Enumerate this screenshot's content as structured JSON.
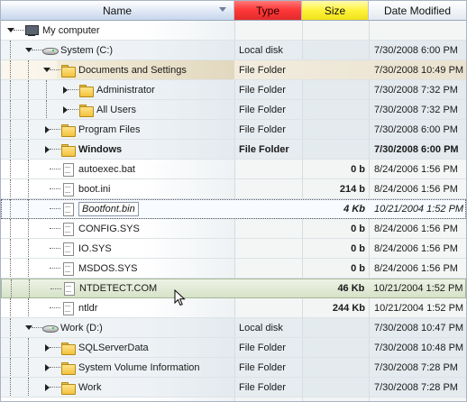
{
  "columns": {
    "name": "Name",
    "type": "Type",
    "size": "Size",
    "date": "Date Modified"
  },
  "colors": {
    "type_header": "#ff3a3a",
    "size_header": "#fff23a",
    "name_header": "#c6d6ec"
  },
  "rows": [
    {
      "name": "My computer",
      "type": "",
      "size": "",
      "date": "",
      "icon": "computer-icon",
      "level": 0,
      "expander": "open"
    },
    {
      "name": "System (C:)",
      "type": "Local disk",
      "size": "",
      "date": "7/30/2008 6:00 PM",
      "icon": "drive-icon",
      "level": 1,
      "expander": "open"
    },
    {
      "name": "Documents and Settings",
      "type": "File Folder",
      "size": "",
      "date": "7/30/2008 10:49 PM",
      "icon": "folder-icon",
      "level": 2,
      "expander": "open"
    },
    {
      "name": "Administrator",
      "type": "File Folder",
      "size": "",
      "date": "7/30/2008 7:32 PM",
      "icon": "folder-icon",
      "level": 3,
      "expander": "closed"
    },
    {
      "name": "All Users",
      "type": "File Folder",
      "size": "",
      "date": "7/30/2008 7:32 PM",
      "icon": "folder-icon",
      "level": 3,
      "expander": "closed"
    },
    {
      "name": "Program Files",
      "type": "File Folder",
      "size": "",
      "date": "7/30/2008 6:00 PM",
      "icon": "folder-icon",
      "level": 2,
      "expander": "closed"
    },
    {
      "name": "Windows",
      "type": "File Folder",
      "size": "",
      "date": "7/30/2008 6:00 PM",
      "icon": "folder-icon",
      "level": 2,
      "expander": "closed"
    },
    {
      "name": "autoexec.bat",
      "type": "",
      "size": "0 b",
      "date": "8/24/2006 1:56 PM",
      "icon": "file-icon",
      "level": 2,
      "expander": "none"
    },
    {
      "name": "boot.ini",
      "type": "",
      "size": "214 b",
      "date": "8/24/2006 1:56 PM",
      "icon": "file-icon",
      "level": 2,
      "expander": "none"
    },
    {
      "name": "Bootfont.bin",
      "type": "",
      "size": "4 Kb",
      "date": "10/21/2004 1:52 PM",
      "icon": "file-icon",
      "level": 2,
      "expander": "none"
    },
    {
      "name": "CONFIG.SYS",
      "type": "",
      "size": "0 b",
      "date": "8/24/2006 1:56 PM",
      "icon": "file-icon",
      "level": 2,
      "expander": "none"
    },
    {
      "name": "IO.SYS",
      "type": "",
      "size": "0 b",
      "date": "8/24/2006 1:56 PM",
      "icon": "file-icon",
      "level": 2,
      "expander": "none"
    },
    {
      "name": "MSDOS.SYS",
      "type": "",
      "size": "0 b",
      "date": "8/24/2006 1:56 PM",
      "icon": "file-icon",
      "level": 2,
      "expander": "none"
    },
    {
      "name": "NTDETECT.COM",
      "type": "",
      "size": "46 Kb",
      "date": "10/21/2004 1:52 PM",
      "icon": "file-icon",
      "level": 2,
      "expander": "none"
    },
    {
      "name": "ntldr",
      "type": "",
      "size": "244 Kb",
      "date": "10/21/2004 1:52 PM",
      "icon": "file-icon",
      "level": 2,
      "expander": "none"
    },
    {
      "name": "Work (D:)",
      "type": "Local disk",
      "size": "",
      "date": "7/30/2008 10:47 PM",
      "icon": "drive-icon",
      "level": 1,
      "expander": "open"
    },
    {
      "name": "SQLServerData",
      "type": "File Folder",
      "size": "",
      "date": "7/30/2008 10:48 PM",
      "icon": "folder-icon",
      "level": 2,
      "expander": "closed"
    },
    {
      "name": "System Volume Information",
      "type": "File Folder",
      "size": "",
      "date": "7/30/2008 7:28 PM",
      "icon": "folder-icon",
      "level": 2,
      "expander": "closed"
    },
    {
      "name": "Work",
      "type": "File Folder",
      "size": "",
      "date": "7/30/2008 7:28 PM",
      "icon": "folder-icon",
      "level": 2,
      "expander": "closed"
    }
  ]
}
